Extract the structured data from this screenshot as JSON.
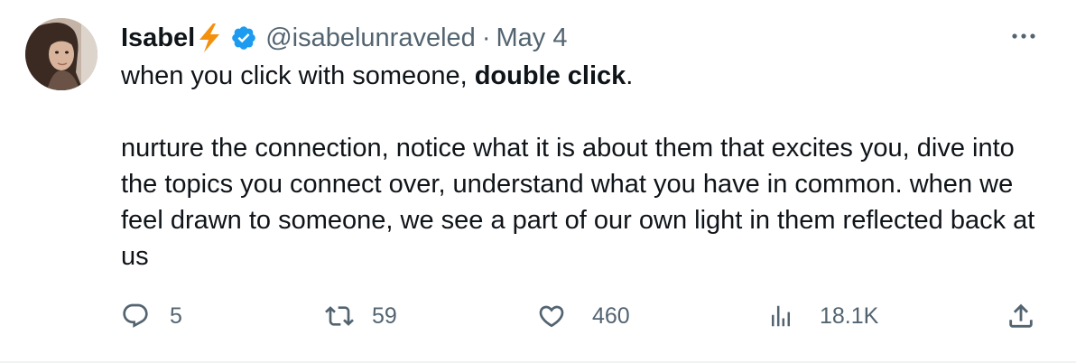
{
  "tweet": {
    "author": {
      "display_name": "Isabel",
      "handle": "@isabelunraveled",
      "verified": true,
      "name_emoji_icon": "lightning-bolt-icon"
    },
    "separator": "·",
    "date": "May 4",
    "more_icon": "ellipsis-icon",
    "body": {
      "line1_prefix": "when you click with someone, ",
      "line1_bold": "double click",
      "line1_suffix": ".",
      "paragraph2": "nurture the connection, notice what it is about them that excites you, dive into the topics you connect over, understand what you have in common. when we feel drawn to someone, we see a part of our own light in them reflected back at us"
    },
    "actions": {
      "replies": "5",
      "retweets": "59",
      "likes": "460",
      "views": "18.1K"
    }
  },
  "colors": {
    "text": "#0f1419",
    "secondary": "#536471",
    "verified": "#1d9bf0",
    "bolt": "#f4900c",
    "divider": "#eff3f4"
  }
}
